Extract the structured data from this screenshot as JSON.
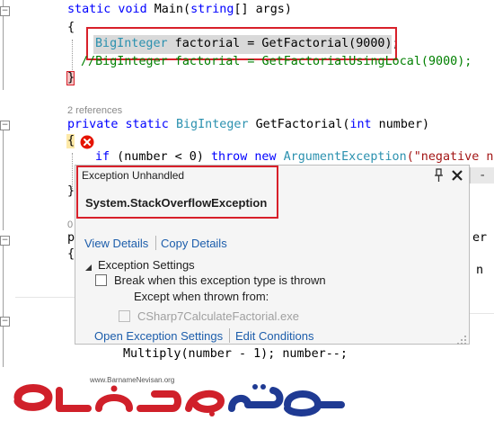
{
  "editor": {
    "line_main": "static void Main(string[] args)",
    "brace_open": "{",
    "brace_close": "}",
    "line_highlight_type": "BigInteger",
    "line_highlight_rest": " factorial = GetFactorial(9000);",
    "line_comment": "//BigInteger factorial = GetFactorialUsingLocal(9000);",
    "references": "2 references",
    "method_sig_kw": "private static",
    "method_sig_type": "BigInteger",
    "method_sig_name": " GetFactorial(",
    "method_sig_int": "int",
    "method_sig_end": " number)",
    "if_line_pre": "if (number < 0) ",
    "if_line_throw": "throw new",
    "if_line_type": " ArgumentException",
    "if_line_str": "(\"negative n",
    "ref_fragment": "0",
    "partial_p": "p",
    "partial_er": "er",
    "partial_n": "n",
    "multiply_line": "Multiply(number - 1); number--;"
  },
  "popup": {
    "title": "Exception Unhandled",
    "exception_type": "System.StackOverflowException",
    "view_details": "View Details",
    "copy_details": "Copy Details",
    "settings_header": "Exception Settings",
    "break_when_label": "Break when this exception type is thrown",
    "except_when_label": "Except when thrown from:",
    "module_label": "CSharp7CalculateFactorial.exe",
    "open_settings": "Open Exception Settings",
    "edit_conditions": "Edit Conditions"
  },
  "watermark": {
    "url": "www.BarnameNevisan.org",
    "logo_text": "برنامه نویسان"
  },
  "colors": {
    "keyword": "#0000ff",
    "type": "#2b91af",
    "string": "#a31515",
    "comment": "#008000",
    "highlight_box": "#d8202a",
    "error_icon": "#e51400",
    "link": "#1c5dab",
    "logo_red": "#d0202a",
    "logo_blue": "#1f3a93"
  },
  "icons": [
    "error-icon",
    "pin-icon",
    "close-icon",
    "collapse-triangle-icon",
    "resize-grip-icon"
  ]
}
